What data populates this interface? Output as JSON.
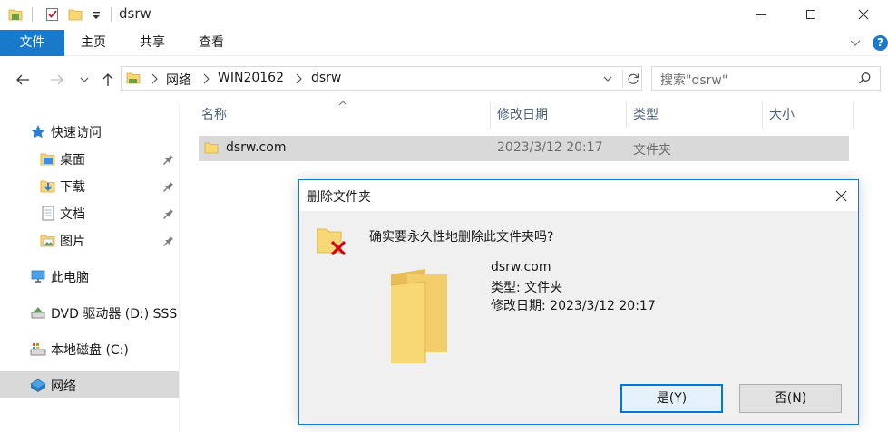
{
  "window": {
    "title": "dsrw",
    "controls": {
      "minimize": "—",
      "maximize": "☐",
      "close": "✕"
    }
  },
  "ribbon": {
    "tabs": [
      "文件",
      "主页",
      "共享",
      "查看"
    ],
    "help": "?"
  },
  "address": {
    "crumbs": [
      "网络",
      "WIN20162",
      "dsrw"
    ]
  },
  "search": {
    "placeholder": "搜索\"dsrw\""
  },
  "nav": {
    "quick_access": "快速访问",
    "pinned": [
      "桌面",
      "下载",
      "文档",
      "图片"
    ],
    "this_pc": "此电脑",
    "dvd": "DVD 驱动器 (D:) SSS",
    "local_disk": "本地磁盘 (C:)",
    "network": "网络"
  },
  "columns": {
    "name": "名称",
    "modified": "修改日期",
    "type": "类型",
    "size": "大小"
  },
  "files": [
    {
      "name": "dsrw.com",
      "modified": "2023/3/12 20:17",
      "type": "文件夹",
      "size": ""
    }
  ],
  "dialog": {
    "title": "删除文件夹",
    "question": "确实要永久性地删除此文件夹吗?",
    "item_name": "dsrw.com",
    "item_type": "类型: 文件夹",
    "item_modified": "修改日期: 2023/3/12 20:17",
    "yes_label": "是(Y)",
    "no_label": "否(N)"
  },
  "colors": {
    "accent": "#1979ca",
    "selection": "#d9d9d9",
    "folder": "#f8d775",
    "delete_x": "#d0021b"
  }
}
